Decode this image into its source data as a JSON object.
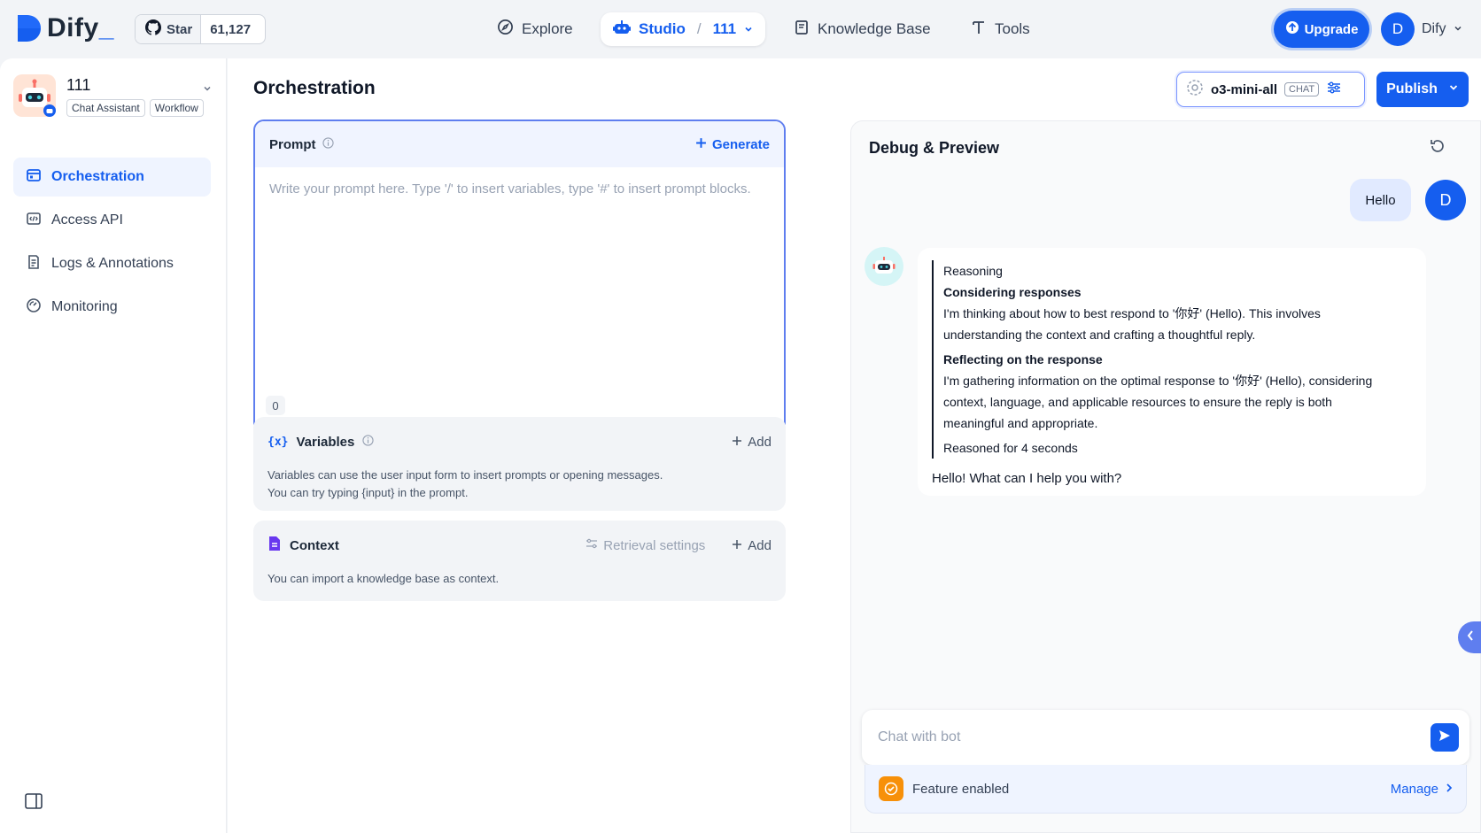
{
  "header": {
    "logo_text": "Dify",
    "github": {
      "label": "Star",
      "count": "61,127"
    },
    "nav": {
      "explore": "Explore",
      "studio": "Studio",
      "app_name": "111",
      "knowledge": "Knowledge Base",
      "tools": "Tools"
    },
    "upgrade": "Upgrade",
    "user": {
      "initial": "D",
      "name": "Dify"
    }
  },
  "sidebar": {
    "app_name": "111",
    "tags": [
      "Chat Assistant",
      "Workflow"
    ],
    "items": [
      {
        "label": "Orchestration",
        "icon": "orchestration-icon",
        "active": true
      },
      {
        "label": "Access API",
        "icon": "api-icon",
        "active": false
      },
      {
        "label": "Logs & Annotations",
        "icon": "logs-icon",
        "active": false
      },
      {
        "label": "Monitoring",
        "icon": "monitoring-icon",
        "active": false
      }
    ]
  },
  "orchestration": {
    "title": "Orchestration",
    "model": {
      "name": "o3-mini-all",
      "mode": "CHAT"
    },
    "publish": "Publish",
    "prompt": {
      "label": "Prompt",
      "generate": "Generate",
      "placeholder": "Write your prompt here. Type '/' to insert variables, type '#' to insert prompt blocks.",
      "count": "0"
    },
    "variables": {
      "glyph": "{x}",
      "title": "Variables",
      "add": "Add",
      "line1": "Variables can use the user input form to insert prompts or opening messages.",
      "line2": "You can try typing {input} in the prompt."
    },
    "context": {
      "title": "Context",
      "retrieval": "Retrieval settings",
      "add": "Add",
      "desc": "You can import a knowledge base as context."
    }
  },
  "debug": {
    "title": "Debug & Preview",
    "user_message": "Hello",
    "user_initial": "D",
    "reasoning": {
      "label": "Reasoning",
      "h1": "Considering responses",
      "p1a": "I'm thinking about how to best respond to '你好' (Hello). This involves",
      "p1b": "understanding the context and crafting a thoughtful reply.",
      "h2": "Reflecting on the response",
      "p2a": "I'm gathering information on the optimal response to '你好' (Hello), considering",
      "p2b": "context, language, and applicable resources to ensure the reply is both",
      "p2c": "meaningful and appropriate.",
      "footer": "Reasoned for 4 seconds"
    },
    "answer": "Hello! What can I help you with?",
    "input_placeholder": "Chat with bot",
    "feature": {
      "label": "Feature enabled",
      "manage": "Manage"
    }
  },
  "colors": {
    "accent": "#155eef",
    "active_bg": "#eff4ff",
    "feature": "#f79009"
  }
}
